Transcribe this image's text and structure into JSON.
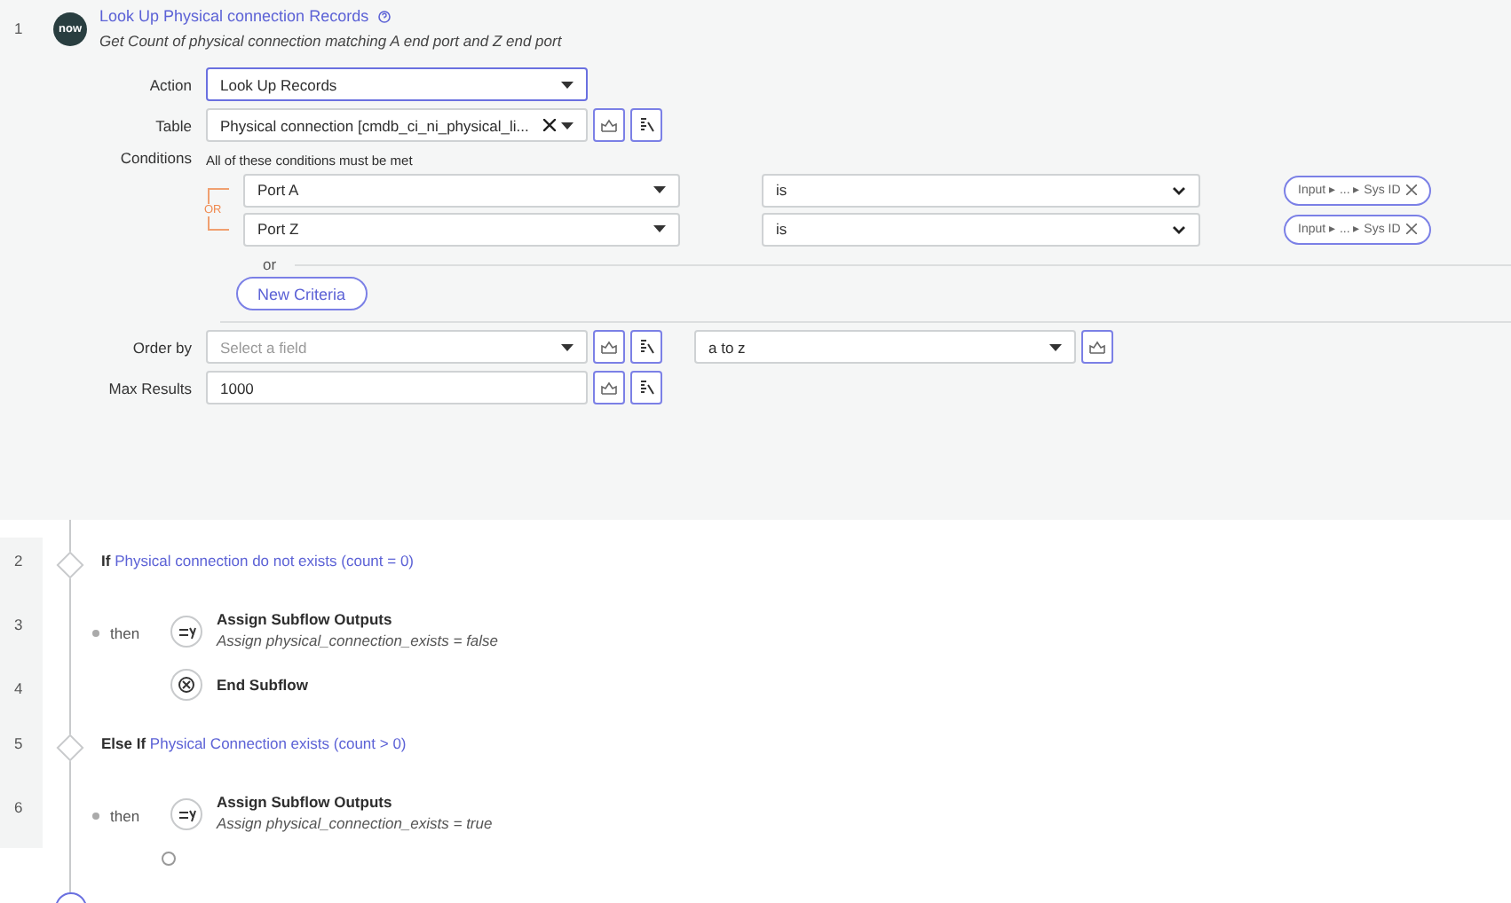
{
  "step": {
    "number": "1",
    "logo": "now",
    "title": "Look Up Physical connection Records",
    "subtitle": "Get Count of physical connection matching A end port and Z end port"
  },
  "action": {
    "label": "Action",
    "value": "Look Up Records",
    "focused": true
  },
  "table": {
    "label": "Table",
    "value": "Physical connection [cmdb_ci_ni_physical_li..."
  },
  "conditions": {
    "label": "Conditions",
    "hint": "All of these conditions must be met",
    "joiner": "OR",
    "rows": [
      {
        "field": "Port A",
        "operator": "is",
        "value": "Input ▸ ... ▸ Sys ID"
      },
      {
        "field": "Port Z",
        "operator": "is",
        "value": "Input ▸ ... ▸ Sys ID"
      }
    ],
    "or_label": "or",
    "new_criteria": "New Criteria"
  },
  "order_by": {
    "label": "Order by",
    "placeholder": "Select a field",
    "direction": "a to z"
  },
  "max_results": {
    "label": "Max Results",
    "value": "1000"
  },
  "flow": [
    {
      "kind": "if",
      "number": "2",
      "keyword": "If",
      "condition": "Physical connection do not exists (count = 0)",
      "children": [
        {
          "kind": "assign",
          "number": "3",
          "prefix": "then",
          "title": "Assign Subflow Outputs",
          "subtitle": "Assign physical_connection_exists = false"
        },
        {
          "kind": "end",
          "number": "4",
          "title": "End Subflow"
        }
      ]
    },
    {
      "kind": "if",
      "number": "5",
      "keyword": "Else If",
      "condition": "Physical Connection exists (count > 0)",
      "children": [
        {
          "kind": "assign",
          "number": "6",
          "prefix": "then",
          "title": "Assign Subflow Outputs",
          "subtitle": "Assign physical_connection_exists = true"
        }
      ]
    }
  ]
}
